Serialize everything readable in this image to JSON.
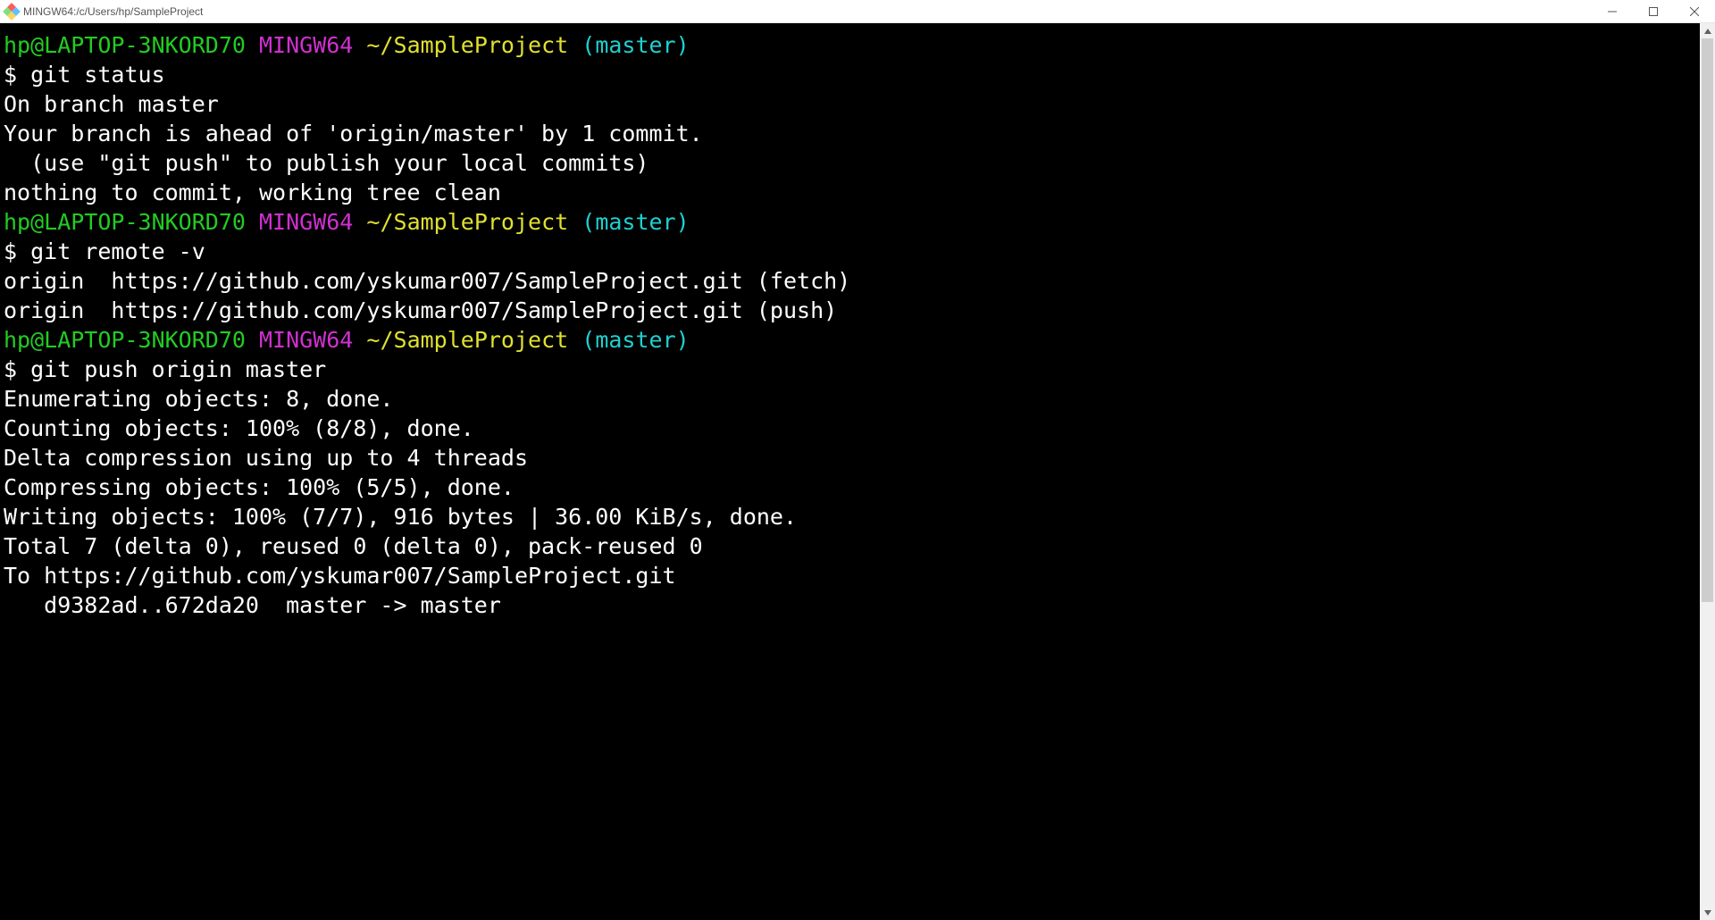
{
  "window": {
    "title": "MINGW64:/c/Users/hp/SampleProject"
  },
  "prompt": {
    "user_host": "hp@LAPTOP-3NKORD70",
    "env": "MINGW64",
    "path": "~/SampleProject",
    "branch": "(master)"
  },
  "blocks": [
    {
      "command": "$ git status",
      "output": [
        "On branch master",
        "Your branch is ahead of 'origin/master' by 1 commit.",
        "  (use \"git push\" to publish your local commits)",
        "",
        "nothing to commit, working tree clean",
        ""
      ]
    },
    {
      "command": "$ git remote -v",
      "output": [
        "origin  https://github.com/yskumar007/SampleProject.git (fetch)",
        "origin  https://github.com/yskumar007/SampleProject.git (push)",
        ""
      ]
    },
    {
      "command": "$ git push origin master",
      "output": [
        "Enumerating objects: 8, done.",
        "Counting objects: 100% (8/8), done.",
        "Delta compression using up to 4 threads",
        "Compressing objects: 100% (5/5), done.",
        "Writing objects: 100% (7/7), 916 bytes | 36.00 KiB/s, done.",
        "Total 7 (delta 0), reused 0 (delta 0), pack-reused 0",
        "To https://github.com/yskumar007/SampleProject.git",
        "   d9382ad..672da20  master -> master"
      ]
    }
  ],
  "scrollbar": {
    "thumb_top_pct": 0,
    "thumb_height_pct": 65
  }
}
